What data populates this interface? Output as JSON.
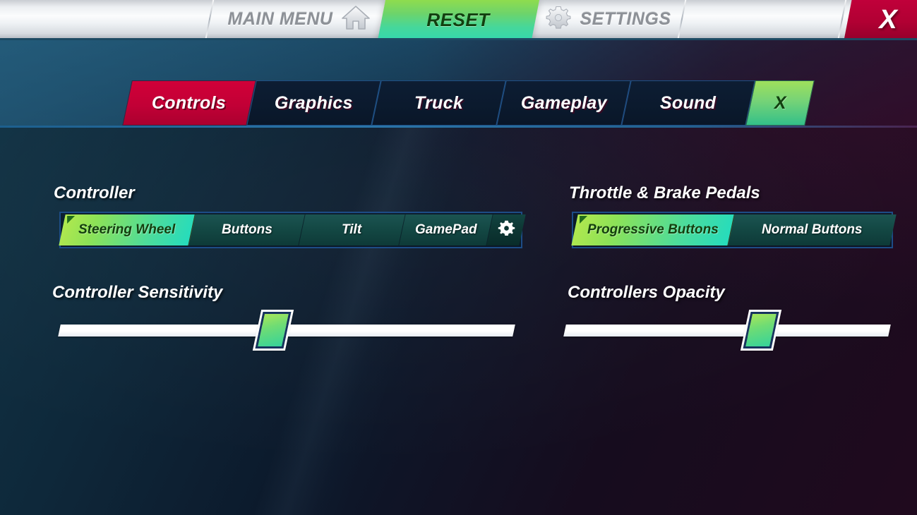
{
  "topbar": {
    "main_menu": {
      "label": "MAIN MENU",
      "icon": "home-icon"
    },
    "reset": {
      "label": "RESET"
    },
    "settings": {
      "label": "SETTINGS",
      "icon": "gear-icon"
    },
    "close": {
      "label": "X"
    }
  },
  "tabs": [
    {
      "label": "Controls",
      "state": "active"
    },
    {
      "label": "Graphics",
      "state": "inactive"
    },
    {
      "label": "Truck",
      "state": "inactive"
    },
    {
      "label": "Gameplay",
      "state": "inactive"
    },
    {
      "label": "Sound",
      "state": "inactive"
    },
    {
      "label": "X",
      "state": "green"
    }
  ],
  "panels": {
    "controller": {
      "title": "Controller",
      "options": [
        {
          "label": "Steering Wheel",
          "selected": true
        },
        {
          "label": "Buttons",
          "selected": false
        },
        {
          "label": "Tilt",
          "selected": false
        },
        {
          "label": "GamePad",
          "selected": false
        }
      ],
      "config_button": {
        "icon": "gear-icon"
      }
    },
    "pedals": {
      "title": "Throttle & Brake Pedals",
      "options": [
        {
          "label": "Progressive Buttons",
          "selected": true
        },
        {
          "label": "Normal Buttons",
          "selected": false
        }
      ]
    },
    "sensitivity": {
      "title": "Controller Sensitivity",
      "value_percent": 47
    },
    "opacity": {
      "title": "Controllers Opacity",
      "value_percent": 60
    }
  },
  "colors": {
    "accent_red": "#c20036",
    "accent_green_start": "#b2e84e",
    "accent_green_end": "#25dcbd",
    "tab_inactive": "#0b1a2e",
    "tab_border": "#1f4f84",
    "panel_border": "#1d4c86",
    "text_primary": "#ffffff",
    "text_on_green": "#14400e"
  }
}
